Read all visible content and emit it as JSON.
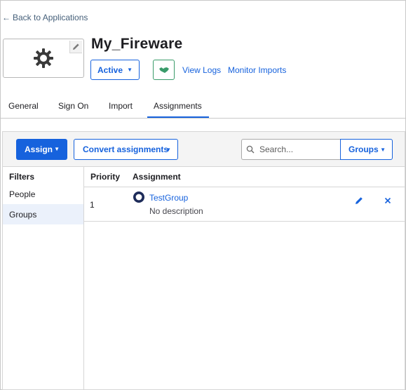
{
  "back_link": {
    "label": "Back to Applications"
  },
  "app": {
    "name": "My_Fireware"
  },
  "header": {
    "status_label": "Active",
    "view_logs_label": "View Logs",
    "monitor_imports_label": "Monitor Imports"
  },
  "tabs": [
    {
      "label": "General"
    },
    {
      "label": "Sign On"
    },
    {
      "label": "Import"
    },
    {
      "label": "Assignments",
      "active": true
    }
  ],
  "toolbar": {
    "assign_label": "Assign",
    "convert_label": "Convert assignments",
    "search_placeholder": "Search...",
    "filter_label": "Groups"
  },
  "filters": {
    "heading": "Filters",
    "items": [
      {
        "label": "People"
      },
      {
        "label": "Groups",
        "selected": true
      }
    ]
  },
  "table": {
    "columns": [
      "Priority",
      "Assignment"
    ],
    "rows": [
      {
        "priority": "1",
        "name": "TestGroup",
        "description": "No description"
      }
    ]
  },
  "colors": {
    "accent": "#1662dd",
    "link": "#1662dd",
    "selected_bg": "#ebf1fb",
    "push_icon": "#3a9b6a"
  },
  "icons": {
    "back": "arrow-left-icon",
    "app_logo": "gear-icon",
    "edit_logo": "pencil-icon",
    "push": "handshake-icon",
    "search": "search-icon",
    "group": "group-icon",
    "edit_row": "pencil-icon",
    "remove_row": "close-icon"
  }
}
